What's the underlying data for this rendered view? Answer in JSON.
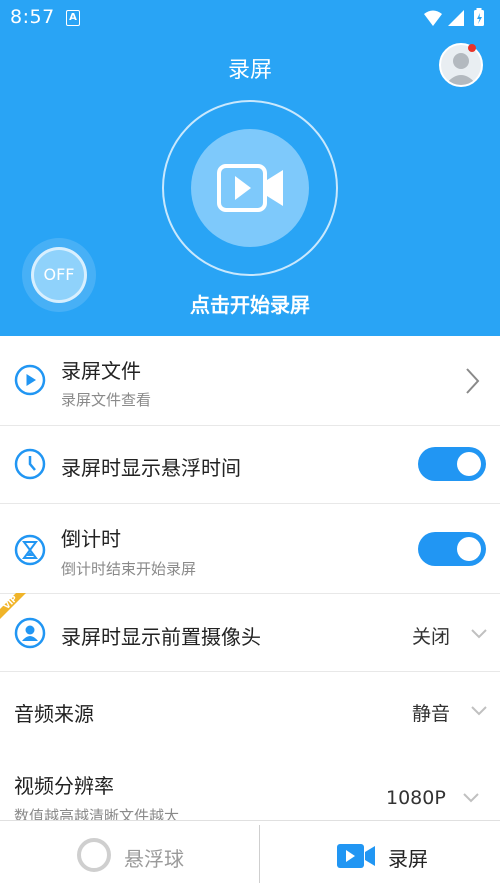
{
  "status_bar": {
    "time": "8:57",
    "app_icon_letter": "A"
  },
  "header": {
    "title": "录屏",
    "record_caption": "点击开始录屏",
    "off_button": "OFF",
    "accent_color": "#29a4f5"
  },
  "settings": {
    "record_files": {
      "title": "录屏文件",
      "subtitle": "录屏文件查看",
      "icon": "play-circle-icon"
    },
    "show_float_time": {
      "title": "录屏时显示悬浮时间",
      "enabled": true,
      "icon": "clock-icon"
    },
    "countdown": {
      "title": "倒计时",
      "subtitle": "倒计时结束开始录屏",
      "enabled": true,
      "icon": "hourglass-icon"
    },
    "front_camera": {
      "title": "录屏时显示前置摄像头",
      "value": "关闭",
      "badge": "VIP",
      "icon": "person-icon"
    },
    "audio_source": {
      "title": "音频来源",
      "value": "静音"
    },
    "video_resolution": {
      "title": "视频分辨率",
      "subtitle": "数值越高越清晰文件越大",
      "value": "1080P"
    }
  },
  "bottom_nav": {
    "float_ball": {
      "label": "悬浮球"
    },
    "record": {
      "label": "录屏"
    }
  }
}
